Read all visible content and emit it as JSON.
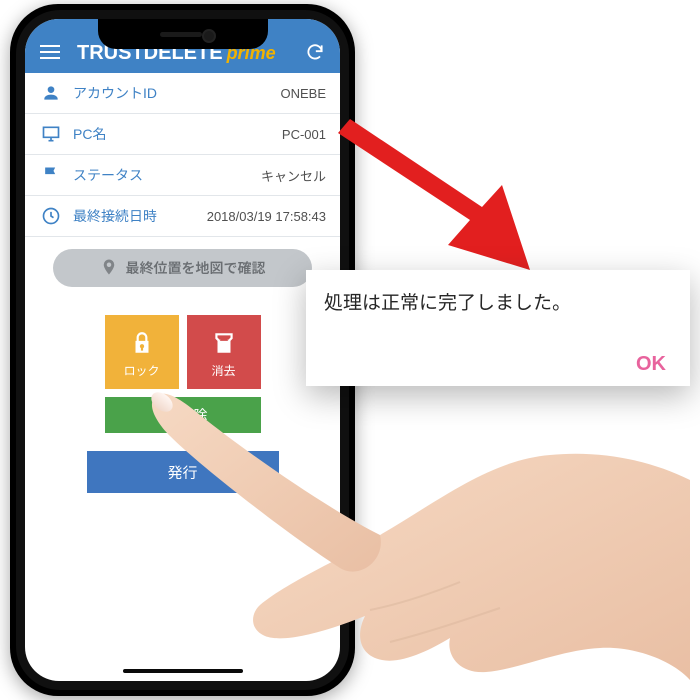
{
  "app": {
    "title_main": "TRUSTDELETE",
    "title_sub": "prime"
  },
  "rows": {
    "account": {
      "label": "アカウントID",
      "value": "ONEBE"
    },
    "pc": {
      "label": "PC名",
      "value": "PC-001"
    },
    "status": {
      "label": "ステータス",
      "value": "キャンセル"
    },
    "last": {
      "label": "最終接続日時",
      "value": "2018/03/19 17:58:43"
    }
  },
  "map_button": "最終位置を地図で確認",
  "buttons": {
    "lock": "ロック",
    "erase": "消去",
    "release": "解除",
    "issue": "発行"
  },
  "dialog": {
    "message": "処理は正常に完了しました。",
    "ok": "OK"
  }
}
